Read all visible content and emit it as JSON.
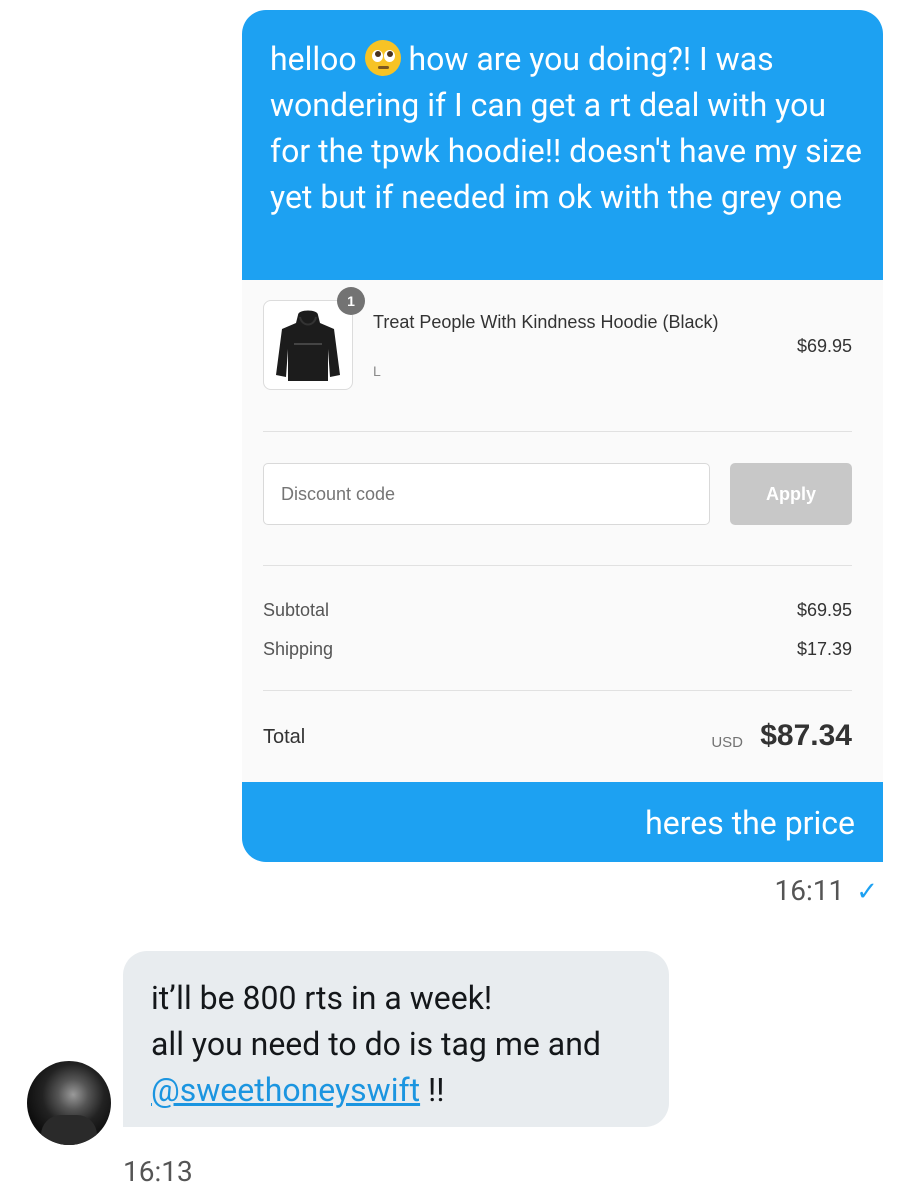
{
  "outgoing_message": {
    "text_before_emoji": "helloo",
    "text_after_emoji": "how are you doing?! I was wondering if I can get a rt deal with you for the tpwk hoodie!! doesn't have my size yet but if needed im ok with the grey one",
    "caption": "heres the price",
    "time": "16:11"
  },
  "order_summary": {
    "item": {
      "name": "Treat People With Kindness Hoodie (Black)",
      "variant": "L",
      "price": "$69.95",
      "quantity": "1"
    },
    "discount": {
      "placeholder": "Discount code",
      "apply_label": "Apply"
    },
    "subtotal_label": "Subtotal",
    "subtotal_value": "$69.95",
    "shipping_label": "Shipping",
    "shipping_value": "$17.39",
    "total_label": "Total",
    "currency": "USD",
    "total_value": "$87.34"
  },
  "incoming_message": {
    "line1": "it’ll be 800 rts in a week!",
    "line2": "all you need to do is tag me and",
    "mention": "@sweethoneyswift",
    "suffix": "!!",
    "time": "16:13"
  },
  "colors": {
    "accent": "#1da1f2",
    "incoming_bubble": "#e8ecef",
    "apply_button": "#c8c8c8"
  },
  "icons": {
    "emoji": "face-with-rolling-eyes",
    "read_receipt": "check-icon"
  }
}
